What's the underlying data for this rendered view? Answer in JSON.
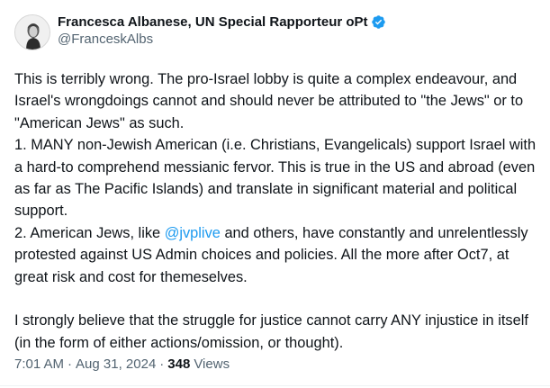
{
  "author": {
    "display_name": "Francesca Albanese, UN Special Rapporteur oPt",
    "handle": "@FranceskAlbs",
    "verified_color": "#1d9bf0"
  },
  "tweet": {
    "line1": "This is terribly wrong. The pro-Israel lobby is quite a complex endeavour, and Israel's wrongdoings cannot and should never be attributed to \"the Jews\" or to \"American Jews\" as such.",
    "point1": "1. MANY non-Jewish American (i.e. Christians, Evangelicals) support Israel with a hard-to comprehend messianic fervor. This is true in the US and abroad (even as far as The Pacific Islands) and translate in significant material and political support.",
    "point2_before": "2. American Jews, like ",
    "point2_mention": "@jvplive",
    "point2_after": " and others, have constantly and unrelentlessly protested against US Admin choices and policies. All the more after Oct7, at great risk and cost for themeselves.",
    "closing": "I strongly believe that the  struggle for justice cannot carry ANY injustice in itself (in the form of either actions/omission, or thought)."
  },
  "meta": {
    "time": "7:01 AM",
    "separator1": "·",
    "date": "Aug 31, 2024",
    "separator2": "·",
    "views_count": "348",
    "views_label": "Views"
  }
}
